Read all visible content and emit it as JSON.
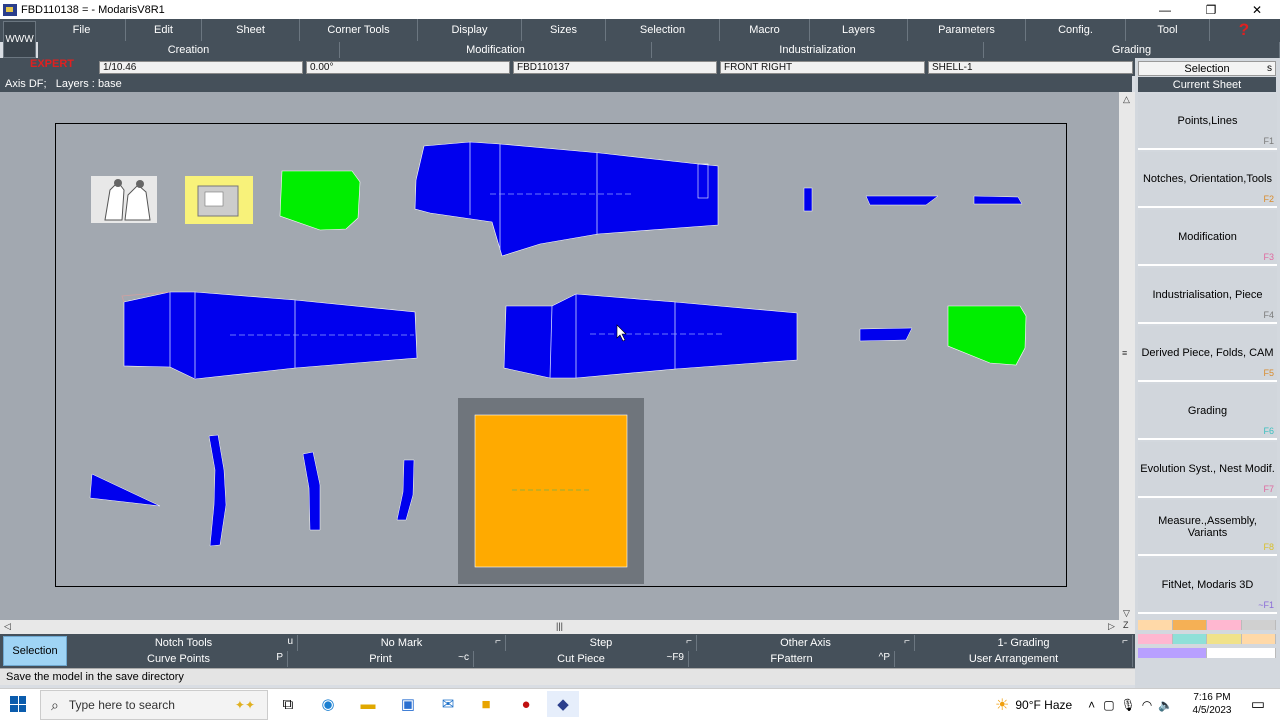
{
  "window": {
    "title": "FBD110138 = - ModarisV8R1",
    "controls": [
      "—",
      "❐",
      "✕"
    ]
  },
  "menu": {
    "www": "WWW",
    "items": [
      "File",
      "Edit",
      "Sheet",
      "Corner Tools",
      "Display",
      "Sizes",
      "Selection",
      "Macro",
      "Layers",
      "Parameters",
      "Config.",
      "Tool"
    ],
    "help": "?"
  },
  "submenu": [
    "Creation",
    "Modification",
    "Industrialization",
    "Grading"
  ],
  "info": {
    "mode": "EXPERT",
    "scale": "1/10.46",
    "angle": "0.00°",
    "model": "FBD110137",
    "piece": "FRONT RIGHT",
    "variant": "SHELL-1"
  },
  "status": {
    "axis": "Axis DF;",
    "layers_label": "Layers :",
    "layers_value": "base"
  },
  "right_panel": {
    "selection": "Selection",
    "selection_key": "s",
    "current_sheet": "Current Sheet",
    "fkeys": [
      {
        "label": "Points,Lines",
        "key": "F1",
        "color": "#7a7a7a"
      },
      {
        "label": "Notches, Orientation,Tools",
        "key": "F2",
        "color": "#d98b2b"
      },
      {
        "label": "Modification",
        "key": "F3",
        "color": "#e06aa0"
      },
      {
        "label": "Industrialisation, Piece",
        "key": "F4",
        "color": "#7a7a7a"
      },
      {
        "label": "Derived Piece, Folds, CAM",
        "key": "F5",
        "color": "#d98b2b"
      },
      {
        "label": "Grading",
        "key": "F6",
        "color": "#3cc0c0"
      },
      {
        "label": "Evolution Syst., Nest Modif.",
        "key": "F7",
        "color": "#e06aa0"
      },
      {
        "label": "Measure.,Assembly, Variants",
        "key": "F8",
        "color": "#d9c02b"
      },
      {
        "label": "FitNet, Modaris 3D",
        "key": "~F1",
        "color": "#8a6ad8"
      }
    ]
  },
  "bottom": {
    "selection": "Selection",
    "row1": [
      {
        "label": "Notch Tools",
        "key": "u"
      },
      {
        "label": "No Mark",
        "key": "⌐"
      },
      {
        "label": "Step",
        "key": "⌐"
      },
      {
        "label": "Other Axis",
        "key": "⌐"
      },
      {
        "label": "1- Grading",
        "key": "⌐"
      }
    ],
    "row2": [
      {
        "label": "Curve Points",
        "key": "P"
      },
      {
        "label": "Print",
        "key": "~c"
      },
      {
        "label": "Cut Piece",
        "key": "~F9"
      },
      {
        "label": "FPattern",
        "key": "^P"
      },
      {
        "label": "User Arrangement",
        "key": ""
      }
    ]
  },
  "message": "Save the model in the save directory",
  "taskbar": {
    "search_placeholder": "Type here to search",
    "weather": "90°F  Haze",
    "time": "7:16 PM",
    "date": "4/5/2023"
  },
  "colors": {
    "piece_blue": "#0000ee",
    "piece_green": "#00ee00",
    "piece_orange": "#ffaa00",
    "canvas_bg": "#a2a8b0",
    "toolbar_bg": "#45505a"
  }
}
